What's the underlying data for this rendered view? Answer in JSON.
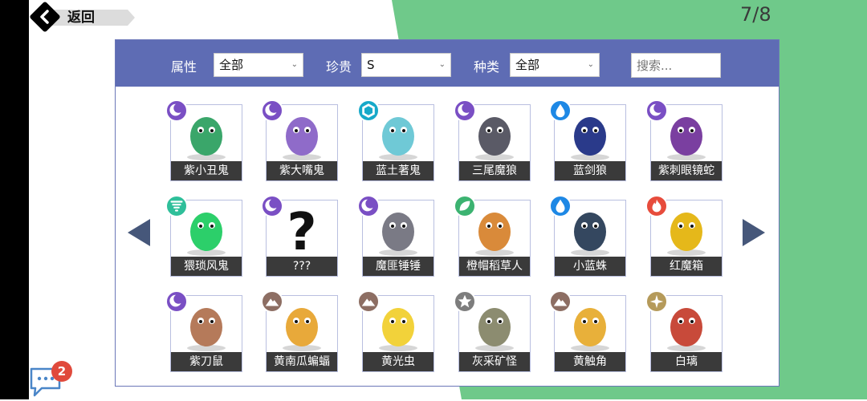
{
  "nav": {
    "back_label": "返回",
    "page_counter": "7/8"
  },
  "filters": {
    "attribute_label": "属性",
    "attribute_value": "全部",
    "rarity_label": "珍贵",
    "rarity_value": "S",
    "kind_label": "种类",
    "kind_value": "全部",
    "search_placeholder": "搜索..."
  },
  "colors": {
    "filter_bar": "#5e6cb4",
    "green_bg": "#6fc98a",
    "name_bar": "#3a3a3a",
    "dark": "#7a4fc4",
    "water": "#1e88e5",
    "ice": "#17a9c9",
    "wind": "#2fbf9a",
    "grass": "#3cb371",
    "fire": "#e74c3c",
    "earth": "#8d6e63",
    "neutral": "#7d7d7d",
    "light": "#b59a5a"
  },
  "creatures": [
    {
      "name": "紫小丑鬼",
      "element": "dark",
      "icon": "moon-icon",
      "art": "#3aa66a"
    },
    {
      "name": "紫大嘴鬼",
      "element": "dark",
      "icon": "moon-icon",
      "art": "#8f6bc9"
    },
    {
      "name": "蓝土著鬼",
      "element": "ice",
      "icon": "hexagon-icon",
      "art": "#6fc9d6"
    },
    {
      "name": "三尾魔狼",
      "element": "dark",
      "icon": "moon-icon",
      "art": "#5a5a66"
    },
    {
      "name": "蓝剑狼",
      "element": "water",
      "icon": "water-drop-icon",
      "art": "#2a3a8a"
    },
    {
      "name": "紫刺眼镜蛇",
      "element": "dark",
      "icon": "moon-icon",
      "art": "#7a3fa0"
    },
    {
      "name": "猥琐风鬼",
      "element": "wind",
      "icon": "tornado-icon",
      "art": "#2ccf6a"
    },
    {
      "name": "???",
      "element": "dark",
      "icon": "moon-icon",
      "art": "#111111"
    },
    {
      "name": "魔匪锤锤",
      "element": "dark",
      "icon": "moon-icon",
      "art": "#7a7a85"
    },
    {
      "name": "橙帽稻草人",
      "element": "grass",
      "icon": "leaf-icon",
      "art": "#d98a3a"
    },
    {
      "name": "小蓝蛛",
      "element": "water",
      "icon": "water-drop-icon",
      "art": "#34475f"
    },
    {
      "name": "红魔箱",
      "element": "fire",
      "icon": "flame-icon",
      "art": "#e5b81a"
    },
    {
      "name": "紫刀鼠",
      "element": "dark",
      "icon": "moon-icon",
      "art": "#b57a5a"
    },
    {
      "name": "黄南瓜蝙蝠",
      "element": "earth",
      "icon": "mountain-icon",
      "art": "#e8a93a"
    },
    {
      "name": "黄光虫",
      "element": "earth",
      "icon": "mountain-icon",
      "art": "#f2d23a"
    },
    {
      "name": "灰采矿怪",
      "element": "neutral",
      "icon": "star-icon",
      "art": "#8c8c70"
    },
    {
      "name": "黄触角",
      "element": "earth",
      "icon": "mountain-icon",
      "art": "#e8b03a"
    },
    {
      "name": "白璃",
      "element": "light",
      "icon": "sparkle-icon",
      "art": "#c84a3a"
    }
  ],
  "chat": {
    "unread_count": "2"
  }
}
